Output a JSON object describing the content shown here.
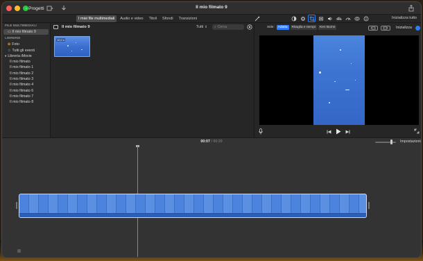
{
  "titlebar": {
    "back_label": "Progetti",
    "title": "Il mio filmato 9"
  },
  "toolbar": {
    "tabs": [
      {
        "label": "I miei file multimediali",
        "active": true
      },
      {
        "label": "Audio e video",
        "active": false
      },
      {
        "label": "Titoli",
        "active": false
      },
      {
        "label": "Sfondi",
        "active": false
      },
      {
        "label": "Transizioni",
        "active": false
      }
    ],
    "reset_all_label": "Inizializza tutto"
  },
  "sidebar": {
    "media_header": "FILE MULTIMEDIALI",
    "project_item": "Il mio filmato 9",
    "libraries_header": "LIBRERIE",
    "photos_item": "Foto",
    "all_events_item": "Tutti gli eventi",
    "library_item": "Libreria iMovie",
    "events": [
      "Il mio filmato",
      "Il mio filmato 1",
      "Il mio filmato 2",
      "Il mio filmato 3",
      "Il mio filmato 4",
      "Il mio filmato 6",
      "Il mio filmato 7",
      "Il mio filmato 8"
    ]
  },
  "browser": {
    "title": "Il mio filmato 9",
    "filter_label": "Tutti",
    "search_placeholder": "Cerca",
    "clip_badge": "10,0 s"
  },
  "viewer": {
    "style_label": "Stile:",
    "style_options": [
      "Adatta",
      "Ritaglia e riempi",
      "Ken Burns"
    ],
    "active_style": "Adatta",
    "reset_label": "Inizializza"
  },
  "timeline": {
    "current_time": "00:07",
    "separator": "/",
    "total_time": "00:20",
    "settings_label": "Impostazioni"
  },
  "colors": {
    "accent": "#2f7df6",
    "clip_blue": "#4c83dc"
  }
}
